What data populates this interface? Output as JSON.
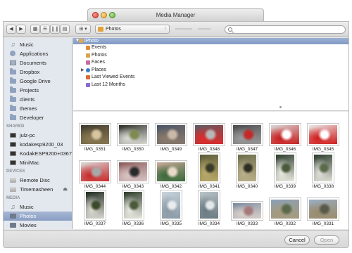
{
  "window": {
    "title": "Media Manager"
  },
  "toolbar": {
    "view_label": "⊞ ▾",
    "location": "Photos",
    "search_placeholder": ""
  },
  "sidebar": {
    "favorites": [
      {
        "label": "Music",
        "icon": "music-note-icon"
      },
      {
        "label": "Applications",
        "icon": "applications-icon"
      },
      {
        "label": "Documents",
        "icon": "documents-icon"
      },
      {
        "label": "Dropbox",
        "icon": "folder-icon"
      },
      {
        "label": "Google Drive",
        "icon": "folder-icon"
      },
      {
        "label": "Projects",
        "icon": "folder-icon"
      },
      {
        "label": "clients",
        "icon": "folder-icon"
      },
      {
        "label": "themes",
        "icon": "folder-icon"
      },
      {
        "label": "Developer",
        "icon": "folder-icon"
      }
    ],
    "shared_header": "SHARED",
    "shared": [
      {
        "label": "julz-pc",
        "icon": "monitor-icon"
      },
      {
        "label": "kodakesp9200_03",
        "icon": "monitor-icon"
      },
      {
        "label": "KodakESP9200+0367",
        "icon": "monitor-icon"
      },
      {
        "label": "MiniMac",
        "icon": "monitor-icon"
      }
    ],
    "devices_header": "DEVICES",
    "devices": [
      {
        "label": "Remote Disc",
        "icon": "disc-icon"
      },
      {
        "label": "Timemasheen",
        "icon": "disk-icon"
      }
    ],
    "media_header": "MEDIA",
    "media": [
      {
        "label": "Music",
        "icon": "music-note-icon"
      },
      {
        "label": "Photos",
        "icon": "photos-icon"
      },
      {
        "label": "Movies",
        "icon": "movies-icon"
      }
    ]
  },
  "iphoto": {
    "root": "iPhoto",
    "items": [
      {
        "label": "Events",
        "color": "#e08a3a"
      },
      {
        "label": "Photos",
        "color": "#d9a44a"
      },
      {
        "label": "Faces",
        "color": "#c46b9a"
      },
      {
        "label": "Places",
        "color": "#3a7cc4"
      },
      {
        "label": "Last Viewed Events",
        "color": "#d96b3a"
      },
      {
        "label": "Last 12 Months",
        "color": "#8a6bd1"
      }
    ]
  },
  "photos": [
    {
      "name": "IMG_0351",
      "colors": [
        "#3f3a2e",
        "#8a7a52",
        "#d9c4a0"
      ]
    },
    {
      "name": "IMG_0350",
      "colors": [
        "#2a2c26",
        "#dcdcd6",
        "#7d8a52"
      ]
    },
    {
      "name": "IMG_0349",
      "colors": [
        "#4a5468",
        "#8a7a6a",
        "#c9b9a6"
      ]
    },
    {
      "name": "IMG_0348",
      "colors": [
        "#5a5e66",
        "#e02a2a",
        "#b8b8b8"
      ]
    },
    {
      "name": "IMG_0347",
      "colors": [
        "#4a4a4e",
        "#9a9a9a",
        "#c42a2a"
      ]
    },
    {
      "name": "IMG_0346",
      "colors": [
        "#d9d9d9",
        "#c81e1e",
        "#ffffff"
      ]
    },
    {
      "name": "IMG_0345",
      "colors": [
        "#e9e9e9",
        "#d01c1c",
        "#ffffff"
      ]
    },
    {
      "name": "IMG_0344",
      "colors": [
        "#d8d8d8",
        "#c92a2a",
        "#a8a8a8"
      ]
    },
    {
      "name": "IMG_0343",
      "colors": [
        "#8a5a5a",
        "#d9c4c4",
        "#2a2a2a"
      ]
    },
    {
      "name": "IMG_0342",
      "colors": [
        "#c9a99a",
        "#3a6a3a",
        "#e9d9c9"
      ]
    },
    {
      "name": "IMG_0341",
      "colors": [
        "#5a5a3a",
        "#b9a96a",
        "#3a3a2a"
      ]
    },
    {
      "name": "IMG_0340",
      "colors": [
        "#6a6a4a",
        "#bab08a",
        "#2e2e22"
      ]
    },
    {
      "name": "IMG_0339",
      "colors": [
        "#2a3a2a",
        "#e9e9e0",
        "#4a5a3a"
      ]
    },
    {
      "name": "IMG_0338",
      "colors": [
        "#2a3a2a",
        "#e0e0d8",
        "#5a6a4a"
      ]
    },
    {
      "name": "IMG_0337",
      "colors": [
        "#1e2a1e",
        "#d9d9d0",
        "#3a4a2a"
      ]
    },
    {
      "name": "IMG_0336",
      "colors": [
        "#2a3a26",
        "#e9e9e2",
        "#4a5a3a"
      ]
    },
    {
      "name": "IMG_0335",
      "colors": [
        "#c9d4dc",
        "#8a9aa6",
        "#e9ecef"
      ]
    },
    {
      "name": "IMG_0334",
      "colors": [
        "#b9c4c9",
        "#6a7a82",
        "#e4e8ea"
      ]
    },
    {
      "name": "IMG_0333",
      "colors": [
        "#7a8aa0",
        "#d9d0c9",
        "#a67a7a"
      ]
    },
    {
      "name": "IMG_0332",
      "colors": [
        "#8aa0b9",
        "#a69a7a",
        "#5a6a4a"
      ]
    },
    {
      "name": "IMG_0331",
      "colors": [
        "#9aaec4",
        "#9a8a6a",
        "#5a5a4a"
      ]
    },
    {
      "name": "",
      "colors": [
        "#7a8a9a",
        "#a6a09a",
        "#c9d0d8"
      ]
    },
    {
      "name": "",
      "colors": [
        "#8aa0b0",
        "#9a9a8a",
        "#cad2d8"
      ]
    },
    {
      "name": "",
      "colors": [
        "#7a9aaa",
        "#8a9a7a",
        "#b8c4cc"
      ]
    },
    {
      "name": "",
      "colors": [
        "#c9c9c9",
        "#ffffff",
        "#8a8a8a"
      ]
    },
    {
      "name": "",
      "colors": [
        "#a6a6a6",
        "#5a5a5a",
        "#d9d9d9"
      ]
    },
    {
      "name": "",
      "colors": [
        "#b9c9d4",
        "#7a8a6a",
        "#5a6a7a"
      ]
    },
    {
      "name": "",
      "colors": [
        "#c9b9a6",
        "#7a5a4a",
        "#a89a8a"
      ]
    }
  ],
  "footer": {
    "cancel_label": "Cancel",
    "open_label": "Open"
  }
}
